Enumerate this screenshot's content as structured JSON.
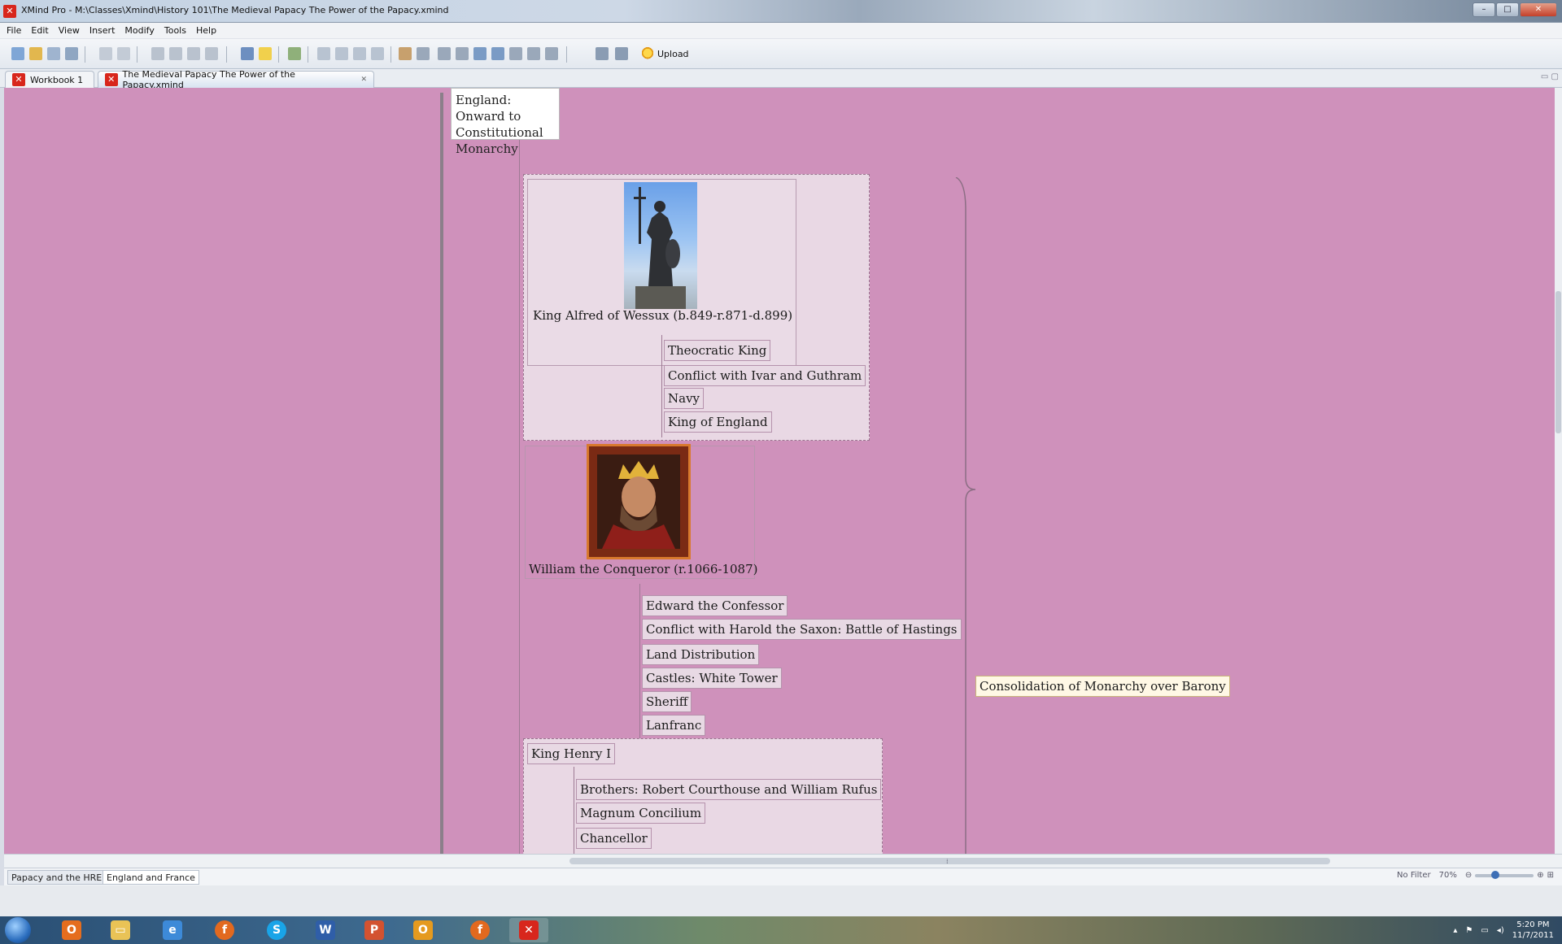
{
  "window": {
    "title": "XMind Pro - M:\\Classes\\Xmind\\History 101\\The Medieval Papacy  The Power of the Papacy.xmind",
    "app_icon": "xmind-icon"
  },
  "menu": [
    "File",
    "Edit",
    "View",
    "Insert",
    "Modify",
    "Tools",
    "Help"
  ],
  "toolbar": {
    "upload_label": "Upload"
  },
  "tabs": [
    {
      "label": "Workbook 1"
    },
    {
      "label": "The Medieval Papacy  The Power of the Papacy.xmind",
      "active": true
    }
  ],
  "map": {
    "background": "#cf91bb",
    "root_topic": "England: Onward to Constitutional Monarchy",
    "alfred": {
      "title": "King Alfred of Wessux (b.849-r.871-d.899)",
      "image": "statue-of-king-alfred",
      "subtopics": [
        "Theocratic King",
        "Conflict with Ivar and Guthram",
        "Navy",
        "King of England"
      ]
    },
    "william": {
      "title": "William the Conqueror (r.1066-1087)",
      "image": "portrait-of-william-the-conqueror",
      "subtopics": [
        "Edward the Confessor",
        "Conflict with Harold the Saxon: Battle of Hastings",
        "Land Distribution",
        "Castles: White Tower",
        "Sheriff",
        "Lanfranc"
      ]
    },
    "henry": {
      "title": "King Henry I",
      "subtopics": [
        "Brothers: Robert Courthouse and William Rufus",
        "Magnum Concilium",
        "Chancellor"
      ]
    },
    "summary": "Consolidation of Monarchy over Barony"
  },
  "sheets": [
    {
      "label": "Papacy and the HRE"
    },
    {
      "label": "England and France",
      "active": true
    }
  ],
  "status": {
    "filter": "No Filter",
    "zoom": "70%"
  },
  "taskbar": {
    "apps": [
      "windows-explorer",
      "outlook-icon",
      "file-explorer",
      "internet-explorer",
      "firefox",
      "skype",
      "word",
      "powerpoint",
      "outlook",
      "firefox",
      "xmind"
    ],
    "time": "5:20 PM",
    "date": "11/7/2011"
  }
}
